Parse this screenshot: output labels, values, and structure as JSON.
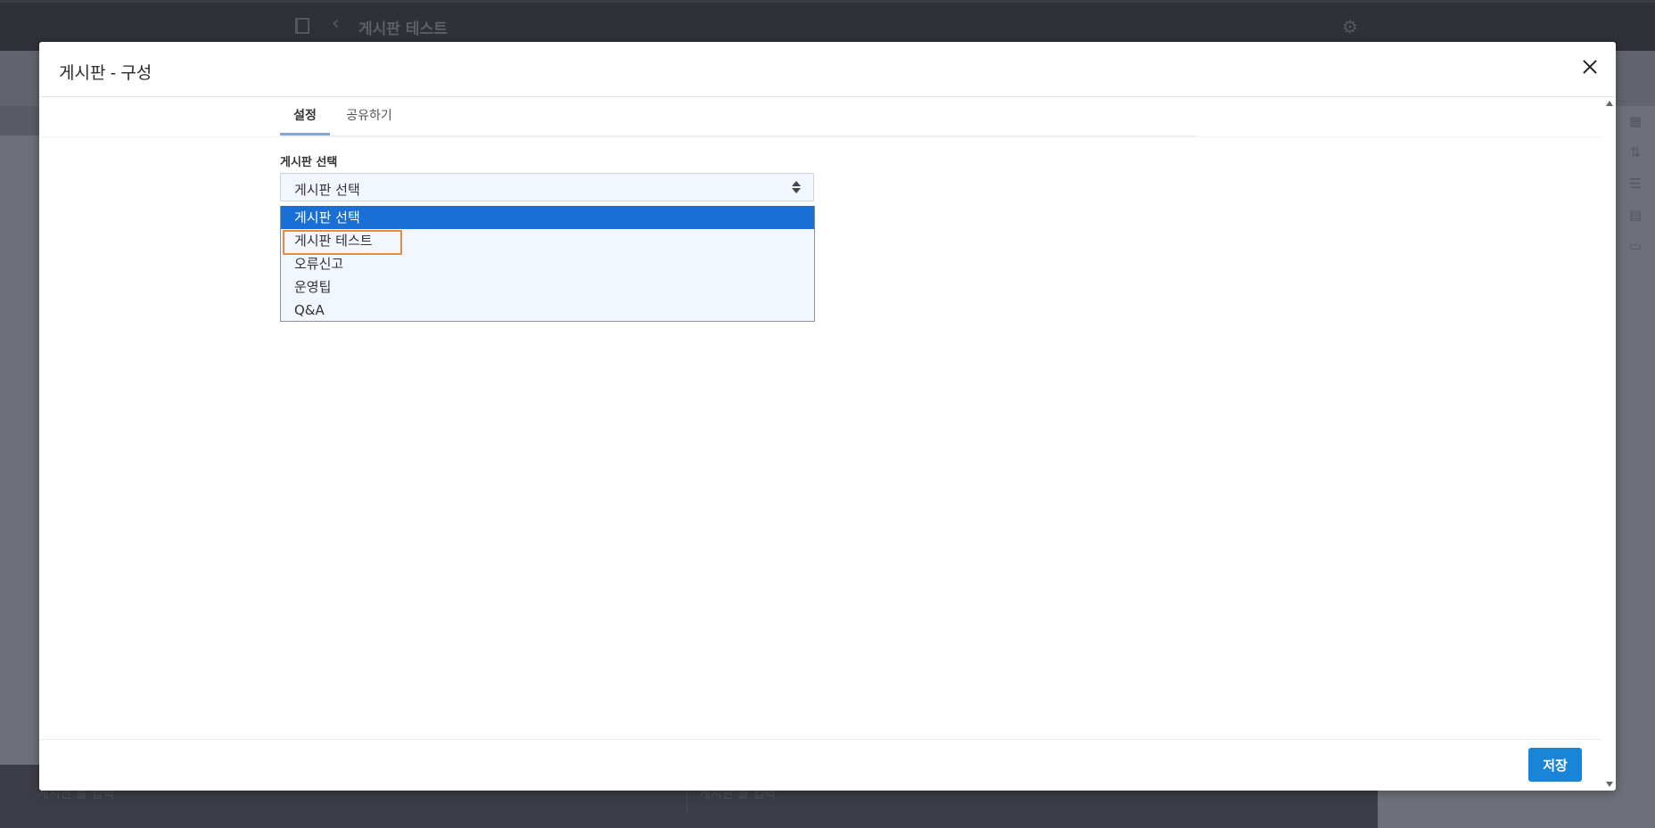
{
  "background": {
    "title": "게시판 테스트",
    "bottom_left_text": "게시판 을 입력",
    "bottom_mid_text": "게시판 을 입력"
  },
  "modal": {
    "title": "게시판 - 구성",
    "tabs": [
      {
        "label": "설정",
        "active": true
      },
      {
        "label": "공유하기",
        "active": false
      }
    ],
    "field": {
      "label": "게시판 선택",
      "selected_value": "게시판 선택",
      "options": [
        "게시판 선택",
        "게시판 테스트",
        "오류신고",
        "운영팁",
        "Q&A"
      ],
      "highlighted_option": "게시판 선택",
      "focused_option": "게시판 테스트"
    },
    "save_label": "저장"
  },
  "colors": {
    "accent": "#1a84d6",
    "selected_option": "#1a6fd6",
    "focus_outline": "#ef8a3a",
    "tab_underline": "#7fa6e4"
  }
}
